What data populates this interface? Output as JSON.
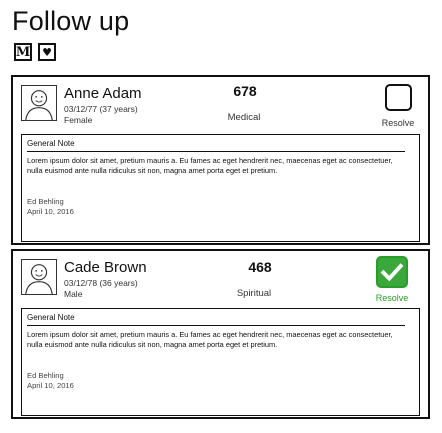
{
  "page": {
    "title": "Follow up",
    "icons": [
      "m-icon",
      "heart-icon"
    ],
    "m_glyph": "M",
    "heart_glyph": "♥"
  },
  "cards": [
    {
      "name": "Anne Adam",
      "dob": "03/12/77 (37 years)",
      "gender": "Female",
      "count": "678",
      "category": "Medical",
      "resolve_label": "Resolve",
      "resolved": false,
      "note": {
        "title": "General Note",
        "body": "Lorem ipsum dolor sit amet, pretium mauris a. Eu fames ac eget hendrerit nec, maecenas eget ac consectetuer, nulla euismod ante nulla ridiculus sit non, magna amet porta eget et pretium.",
        "author": "Ed Behling",
        "date": "April 10, 2016"
      }
    },
    {
      "name": "Cade Brown",
      "dob": "03/12/78 (36 years)",
      "gender": "Male",
      "count": "468",
      "category": "Spiritual",
      "resolve_label": "Resolve",
      "resolved": true,
      "note": {
        "title": "General Note",
        "body": "Lorem ipsum dolor sit amet, pretium mauris a. Eu fames ac eget hendrerit nec, maecenas eget ac consectetuer, nulla euismod ante nulla ridiculus sit non, magna amet porta eget et pretium.",
        "author": "Ed Behling",
        "date": "April 10, 2016"
      }
    }
  ],
  "colors": {
    "resolved_green": "#3aa83a",
    "border": "#111111"
  }
}
